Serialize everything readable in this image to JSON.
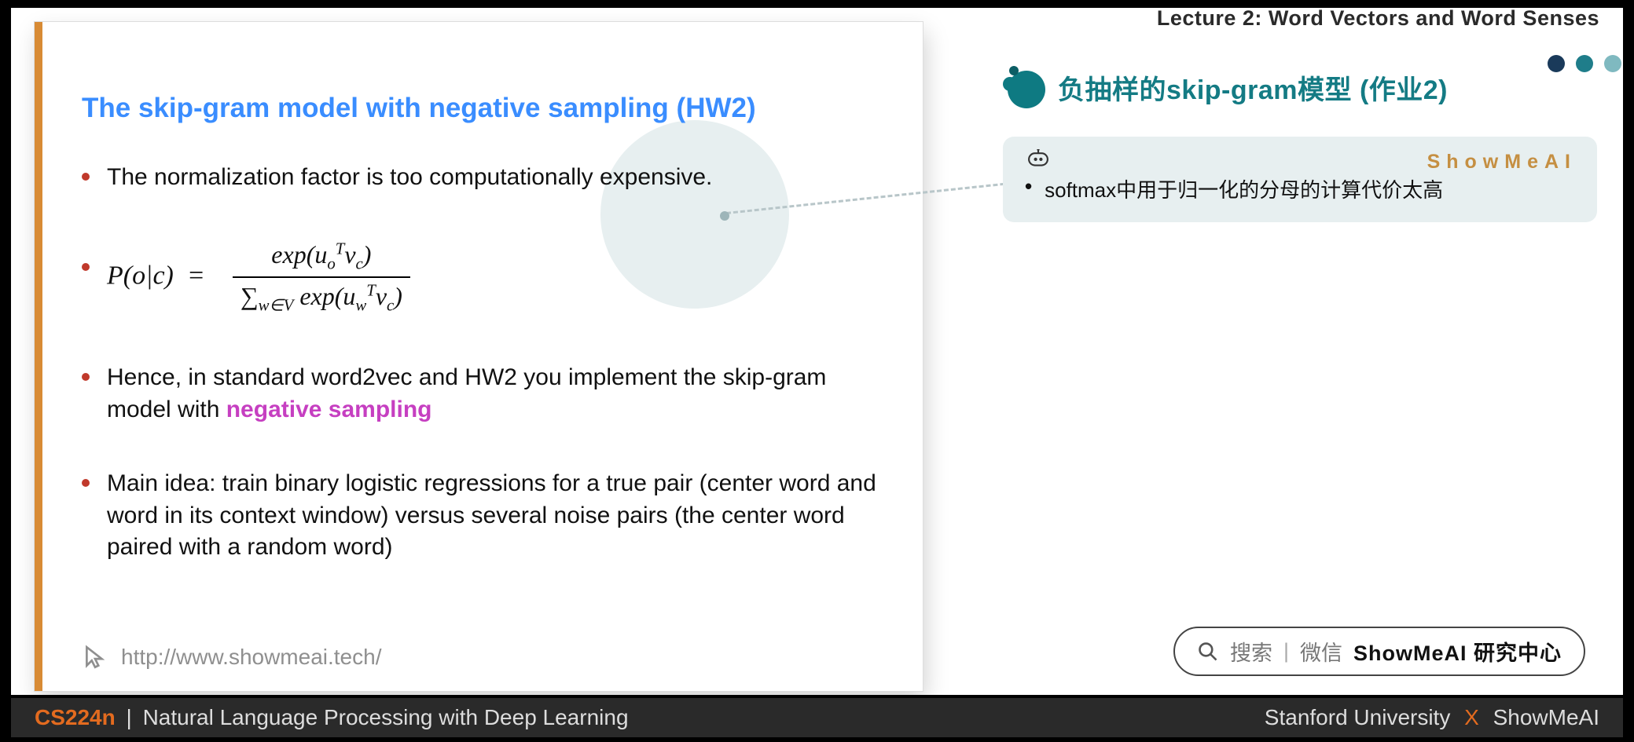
{
  "header": {
    "lecture_label": "Lecture 2:  Word Vectors and Word Senses"
  },
  "slide": {
    "title": "The skip-gram model with negative sampling (HW2)",
    "bullets": {
      "b1": "The normalization factor is too computationally expensive.",
      "formula": {
        "lhs": "P(o|c)  =",
        "num": "exp(uₒᵀv𝒸)",
        "den": "∑_{w∈V} exp(u_wᵀv𝒸)"
      },
      "b3_pre": "Hence, in standard word2vec and HW2 you implement the skip-gram model with ",
      "b3_em": "negative sampling",
      "b4": "Main idea: train binary logistic regressions for a true pair (center word and word in its context window) versus several noise pairs (the center word paired with a random word)"
    },
    "link": "http://www.showmeai.tech/"
  },
  "right": {
    "cn_title": "负抽样的skip-gram模型 (作业2)",
    "tag": "ShowMeAI",
    "note": "softmax中用于归一化的分母的计算代价太高"
  },
  "search": {
    "hint": "搜索",
    "sep": "|",
    "wx": "微信",
    "strong": "ShowMeAI 研究中心"
  },
  "footer": {
    "course": "CS224n",
    "pipe": "|",
    "subtitle": "Natural Language Processing with Deep Learning",
    "uni": "Stanford University",
    "x": "X",
    "org": "ShowMeAI"
  }
}
